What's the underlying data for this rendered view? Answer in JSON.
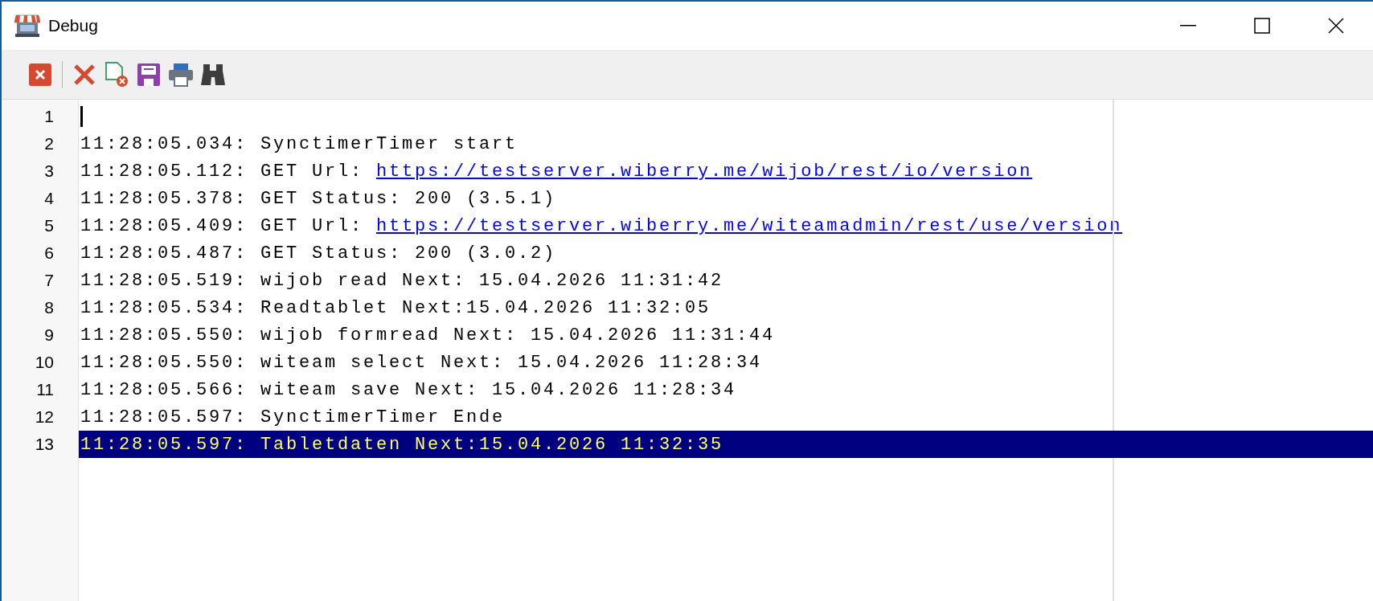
{
  "window": {
    "title": "Debug"
  },
  "editor": {
    "lines": [
      {
        "number": "1",
        "selected": false,
        "cursor": true
      },
      {
        "number": "2",
        "segments": [
          {
            "kind": "plain",
            "text": "11:28:05.034: SynctimerTimer start"
          }
        ],
        "selected": false,
        "cursor": false
      },
      {
        "number": "3",
        "segments": [
          {
            "kind": "plain",
            "text": "11:28:05.112: GET Url: "
          },
          {
            "kind": "link",
            "text": "https://testserver.wiberry.me/wijob/rest/io/version"
          }
        ],
        "selected": false,
        "cursor": false
      },
      {
        "number": "4",
        "segments": [
          {
            "kind": "plain",
            "text": "11:28:05.378: GET Status: 200 (3.5.1)"
          }
        ],
        "selected": false,
        "cursor": false
      },
      {
        "number": "5",
        "segments": [
          {
            "kind": "plain",
            "text": "11:28:05.409: GET Url: "
          },
          {
            "kind": "link",
            "text": "https://testserver.wiberry.me/witeamadmin/rest/use/version"
          }
        ],
        "selected": false,
        "cursor": false
      },
      {
        "number": "6",
        "segments": [
          {
            "kind": "plain",
            "text": "11:28:05.487: GET Status: 200 (3.0.2)"
          }
        ],
        "selected": false,
        "cursor": false
      },
      {
        "number": "7",
        "segments": [
          {
            "kind": "plain",
            "text": "11:28:05.519: wijob read Next: 15.04.2026 11:31:42"
          }
        ],
        "selected": false,
        "cursor": false
      },
      {
        "number": "8",
        "segments": [
          {
            "kind": "plain",
            "text": "11:28:05.534: Readtablet Next:15.04.2026 11:32:05"
          }
        ],
        "selected": false,
        "cursor": false
      },
      {
        "number": "9",
        "segments": [
          {
            "kind": "plain",
            "text": "11:28:05.550: wijob formread Next: 15.04.2026 11:31:44"
          }
        ],
        "selected": false,
        "cursor": false
      },
      {
        "number": "10",
        "segments": [
          {
            "kind": "plain",
            "text": "11:28:05.550: witeam select Next: 15.04.2026 11:28:34"
          }
        ],
        "selected": false,
        "cursor": false
      },
      {
        "number": "11",
        "segments": [
          {
            "kind": "plain",
            "text": "11:28:05.566: witeam save Next: 15.04.2026 11:28:34"
          }
        ],
        "selected": false,
        "cursor": false
      },
      {
        "number": "12",
        "segments": [
          {
            "kind": "plain",
            "text": "11:28:05.597: SynctimerTimer Ende"
          }
        ],
        "selected": false,
        "cursor": false
      },
      {
        "number": "13",
        "segments": [
          {
            "kind": "plain",
            "text": "11:28:05.597: Tabletdaten Next:15.04.2026 11:32:35"
          }
        ],
        "selected": true,
        "cursor": false
      }
    ]
  }
}
